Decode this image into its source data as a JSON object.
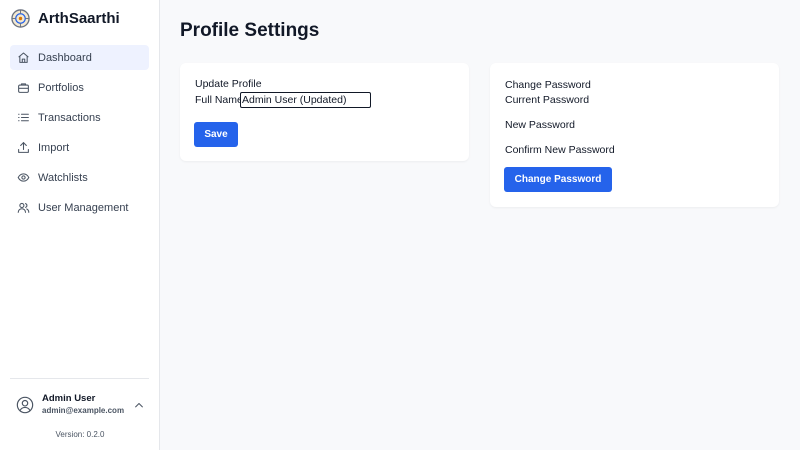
{
  "brand": {
    "name": "ArthSaarthi"
  },
  "nav": {
    "items": [
      {
        "label": "Dashboard",
        "icon": "home-icon"
      },
      {
        "label": "Portfolios",
        "icon": "briefcase-icon"
      },
      {
        "label": "Transactions",
        "icon": "list-icon"
      },
      {
        "label": "Import",
        "icon": "upload-icon"
      },
      {
        "label": "Watchlists",
        "icon": "eye-icon"
      },
      {
        "label": "User Management",
        "icon": "users-icon"
      }
    ],
    "active": "Dashboard"
  },
  "user": {
    "name": "Admin User",
    "email": "admin@example.com"
  },
  "version": "Version: 0.2.0",
  "page": {
    "title": "Profile Settings"
  },
  "profile": {
    "heading": "Update Profile",
    "full_name_label": "Full Name",
    "full_name_value": "Admin User (Updated)",
    "save_label": "Save"
  },
  "password": {
    "heading": "Change Password",
    "current_label": "Current Password",
    "new_label": "New Password",
    "confirm_label": "Confirm New Password",
    "submit_label": "Change Password"
  },
  "colors": {
    "accent": "#2563eb",
    "active_nav_bg": "#eef2ff"
  }
}
